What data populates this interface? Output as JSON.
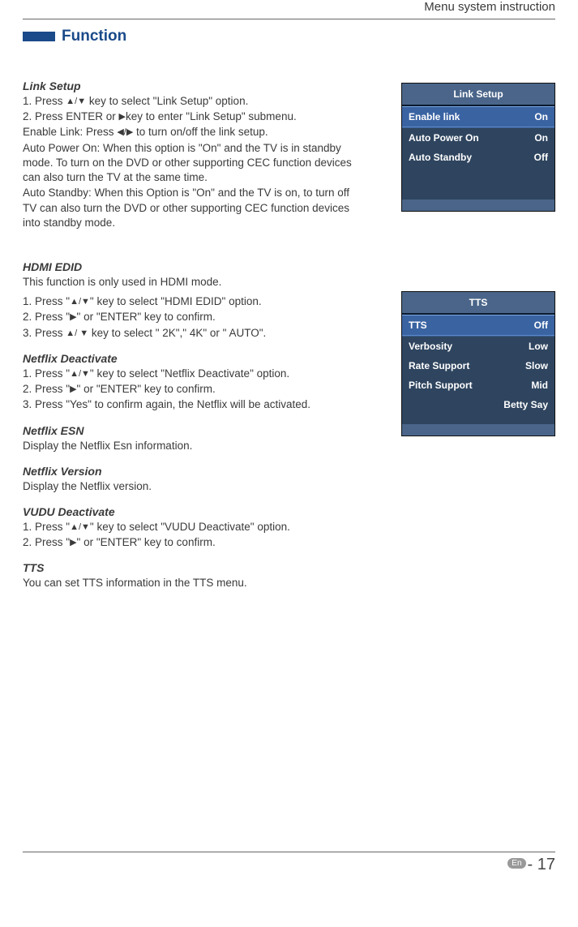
{
  "header": {
    "section": "Menu system instruction"
  },
  "function": {
    "title": "Function"
  },
  "link_setup": {
    "heading": "Link Setup",
    "line1a": "1. Press  ",
    "keys1": "▲/▼",
    "line1b": " key to select \"Link Setup\" option.",
    "line2a": "2. Press ENTER or ",
    "keys2": "▶",
    "line2b": "key to enter \"Link Setup\" submenu.",
    "line3a": "Enable Link: Press  ",
    "keys3": "◀/▶",
    "line3b": "    to turn on/off the link setup.",
    "line4": "Auto Power On: When this option is \"On\" and the TV is in standby mode. To turn on the DVD or other supporting CEC function devices can also turn the TV at the same time.",
    "line5": "Auto Standby: When this Option is \"On\" and the TV is on, to turn off TV can also turn the DVD or other supporting CEC function devices into standby mode."
  },
  "link_menu": {
    "title": "Link Setup",
    "rows": [
      {
        "label": "Enable link",
        "value": "On"
      },
      {
        "label": "Auto Power On",
        "value": "On"
      },
      {
        "label": "Auto Standby",
        "value": "Off"
      }
    ]
  },
  "hdmi": {
    "heading": "HDMI EDID",
    "intro": "This function is only used in HDMI mode.",
    "line1a": "1. Press \"",
    "keys1": "▲/▼",
    "line1b": "\" key to select \"HDMI EDID\" option.",
    "line2a": "2. Press \"",
    "keys2": "▶",
    "line2b": "\" or \"ENTER\" key to confirm.",
    "line3a": "3. Press  ",
    "keys3": "▲/ ▼",
    "line3b": " key to select \" 2K\",\" 4K\" or \" AUTO\"."
  },
  "netflix_deactivate": {
    "heading": "Netflix Deactivate",
    "line1a": "1. Press \"",
    "keys1": "▲/▼",
    "line1b": "\" key to select \"Netflix Deactivate\" option.",
    "line2a": "2. Press \"",
    "keys2": "▶",
    "line2b": "\" or \"ENTER\" key to confirm.",
    "line3": "3. Press \"Yes\" to confirm again, the Netflix will be activated."
  },
  "netflix_esn": {
    "heading": "Netflix ESN",
    "body": "Display the Netflix Esn information."
  },
  "netflix_version": {
    "heading": "Netflix Version",
    "body": "Display the Netflix version."
  },
  "vudu": {
    "heading": "VUDU Deactivate",
    "line1a": "1. Press \"",
    "keys1": "▲/▼",
    "line1b": "\" key to select \"VUDU Deactivate\" option.",
    "line2a": "2. Press \"",
    "keys2": "▶",
    "line2b": "\" or \"ENTER\" key to confirm."
  },
  "tts": {
    "heading": "TTS",
    "body": "You can set TTS information in the TTS menu."
  },
  "tts_menu": {
    "title": "TTS",
    "rows": [
      {
        "label": "TTS",
        "value": "Off"
      },
      {
        "label": "Verbosity",
        "value": "Low"
      },
      {
        "label": "Rate Support",
        "value": "Slow"
      },
      {
        "label": "Pitch Support",
        "value": "Mid"
      }
    ],
    "extra": "Betty Say"
  },
  "footer": {
    "lang": "En",
    "page": " - 17"
  }
}
